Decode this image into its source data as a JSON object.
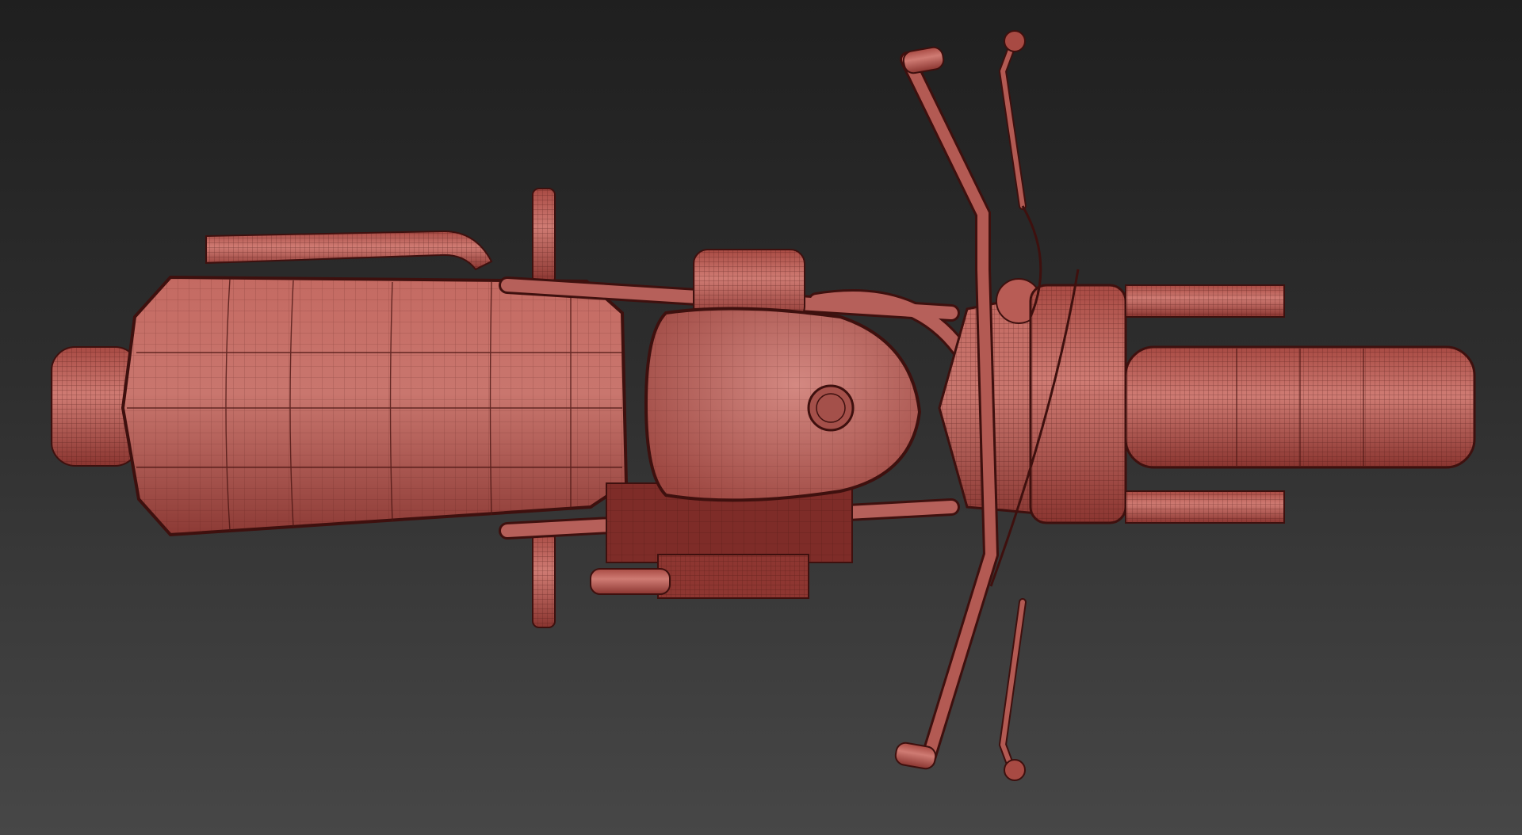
{
  "viewport": {
    "background_top": "#1f1f1f",
    "background_bottom": "#474747"
  },
  "model": {
    "shade_color": "#b5564f",
    "wire_color": "#4a1512",
    "highlight_color": "#d98a84"
  }
}
